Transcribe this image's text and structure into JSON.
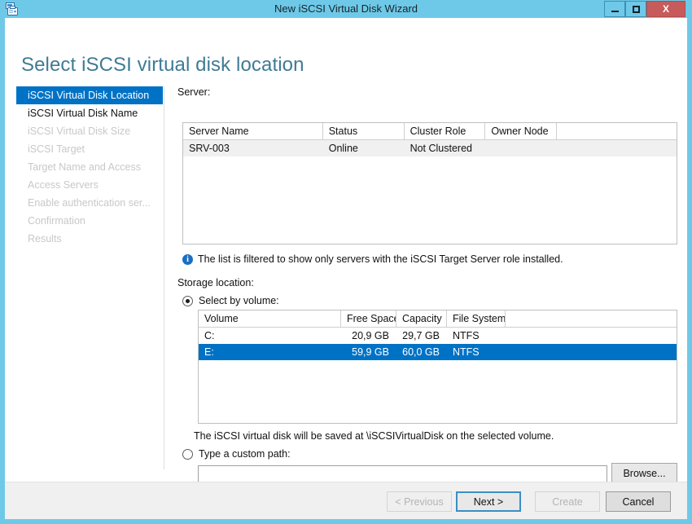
{
  "window": {
    "title": "New iSCSI Virtual Disk Wizard",
    "icon": "iscsi-disk-icon",
    "titlebar_color": "#6ec9e8",
    "minimize_label": "",
    "maximize_label": "",
    "close_label": "X"
  },
  "page": {
    "heading": "Select iSCSI virtual disk location",
    "heading_color": "#3f7b94"
  },
  "sidebar": {
    "items": [
      {
        "label": "iSCSI Virtual Disk Location",
        "state": "active"
      },
      {
        "label": "iSCSI Virtual Disk Name",
        "state": "enabled"
      },
      {
        "label": "iSCSI Virtual Disk Size",
        "state": "disabled"
      },
      {
        "label": "iSCSI Target",
        "state": "disabled"
      },
      {
        "label": "Target Name and Access",
        "state": "disabled"
      },
      {
        "label": "Access Servers",
        "state": "disabled"
      },
      {
        "label": "Enable authentication ser...",
        "state": "disabled"
      },
      {
        "label": "Confirmation",
        "state": "disabled"
      },
      {
        "label": "Results",
        "state": "disabled"
      }
    ],
    "active_color": "#0072c6"
  },
  "main": {
    "server_label": "Server:",
    "server_table": {
      "columns": [
        "Server Name",
        "Status",
        "Cluster Role",
        "Owner Node",
        ""
      ],
      "rows": [
        {
          "cells": [
            "SRV-003",
            "Online",
            "Not Clustered",
            "",
            ""
          ],
          "selected": false,
          "alt": true
        }
      ]
    },
    "info": {
      "icon": "info-icon",
      "glyph": "i",
      "text": "The list is filtered to show only servers with the iSCSI Target Server role installed."
    },
    "storage_label": "Storage location:",
    "radio_volume": {
      "label": "Select by volume:",
      "checked": true
    },
    "volume_table": {
      "columns": [
        "Volume",
        "Free Space",
        "Capacity",
        "File System",
        ""
      ],
      "rows": [
        {
          "cells": [
            "C:",
            "20,9 GB",
            "29,7 GB",
            "NTFS",
            ""
          ],
          "selected": false,
          "alt": false
        },
        {
          "cells": [
            "E:",
            "59,9 GB",
            "60,0 GB",
            "NTFS",
            ""
          ],
          "selected": true,
          "alt": false
        }
      ],
      "selection_color": "#0072c6"
    },
    "save_note": "The iSCSI virtual disk will be saved at \\iSCSIVirtualDisk on the selected volume.",
    "radio_custom": {
      "label": "Type a custom path:",
      "checked": false
    },
    "path_input": {
      "value": "",
      "placeholder": ""
    },
    "browse_button": "Browse..."
  },
  "footer": {
    "previous": "< Previous",
    "next": "Next >",
    "create": "Create",
    "cancel": "Cancel"
  }
}
